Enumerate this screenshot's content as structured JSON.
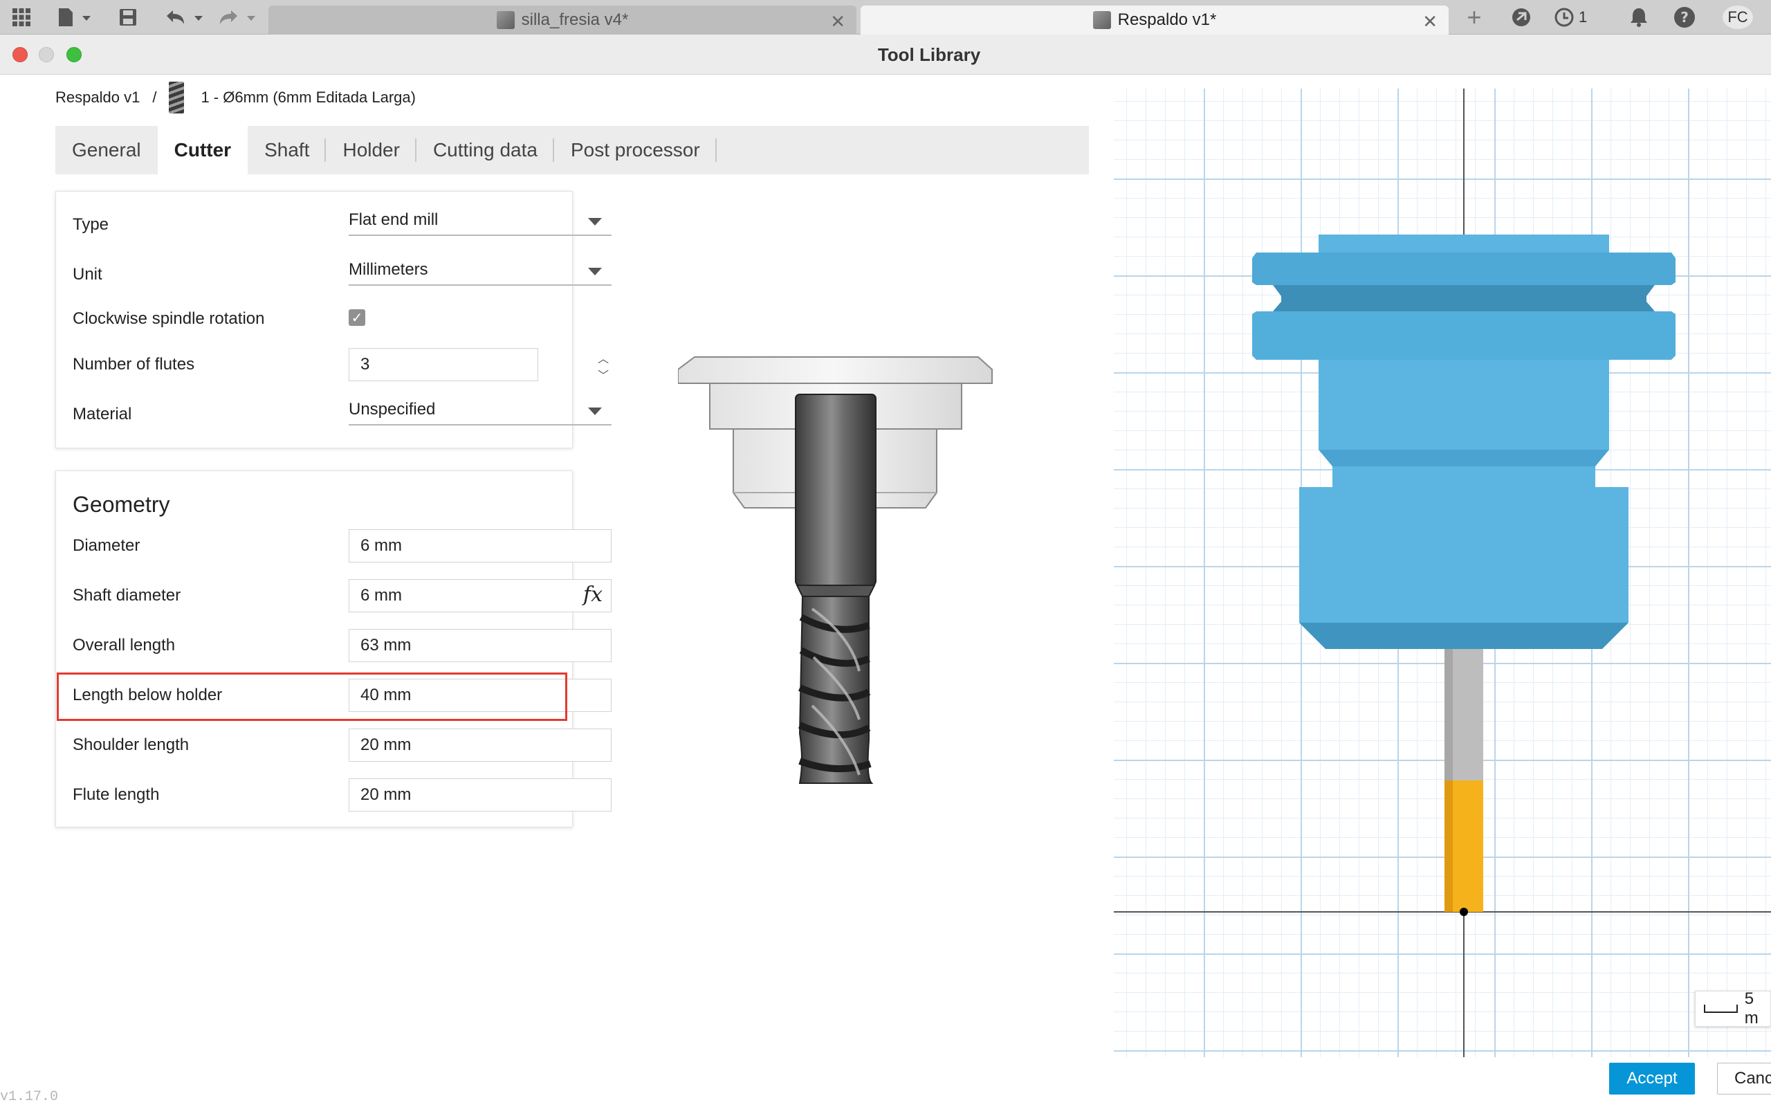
{
  "app_bar": {
    "tabs": [
      {
        "label": "silla_fresia v4*",
        "active": false
      },
      {
        "label": "Respaldo v1*",
        "active": true
      }
    ],
    "job_count": "1",
    "user_initials": "FC"
  },
  "dialog": {
    "title": "Tool Library"
  },
  "breadcrumb": {
    "document": "Respaldo v1",
    "separator": "/",
    "tool": "1 - Ø6mm (6mm Editada Larga)"
  },
  "tabs": [
    "General",
    "Cutter",
    "Shaft",
    "Holder",
    "Cutting data",
    "Post processor"
  ],
  "active_tab": "Cutter",
  "cutter": {
    "type_label": "Type",
    "type_value": "Flat end mill",
    "unit_label": "Unit",
    "unit_value": "Millimeters",
    "clockwise_label": "Clockwise spindle rotation",
    "clockwise_checked": true,
    "flutes_label": "Number of flutes",
    "flutes_value": "3",
    "material_label": "Material",
    "material_value": "Unspecified"
  },
  "geometry": {
    "title": "Geometry",
    "diameter_label": "Diameter",
    "diameter_value": "6 mm",
    "shaft_diameter_label": "Shaft diameter",
    "shaft_diameter_value": "6 mm",
    "fx_label": "fx",
    "overall_length_label": "Overall length",
    "overall_length_value": "63 mm",
    "length_below_holder_label": "Length below holder",
    "length_below_holder_value": "40 mm",
    "shoulder_length_label": "Shoulder length",
    "shoulder_length_value": "20 mm",
    "flute_length_label": "Flute length",
    "flute_length_value": "20 mm"
  },
  "viewport": {
    "scale_label": "5 m",
    "holder_color": "#5bb5e0",
    "flute_color": "#f5b21a",
    "shank_color": "#bdbdbd"
  },
  "buttons": {
    "accept": "Accept",
    "cancel": "Canc"
  },
  "version": "v1.17.0",
  "colors": {
    "accent": "#0696d7",
    "highlight": "#e33b2e"
  }
}
